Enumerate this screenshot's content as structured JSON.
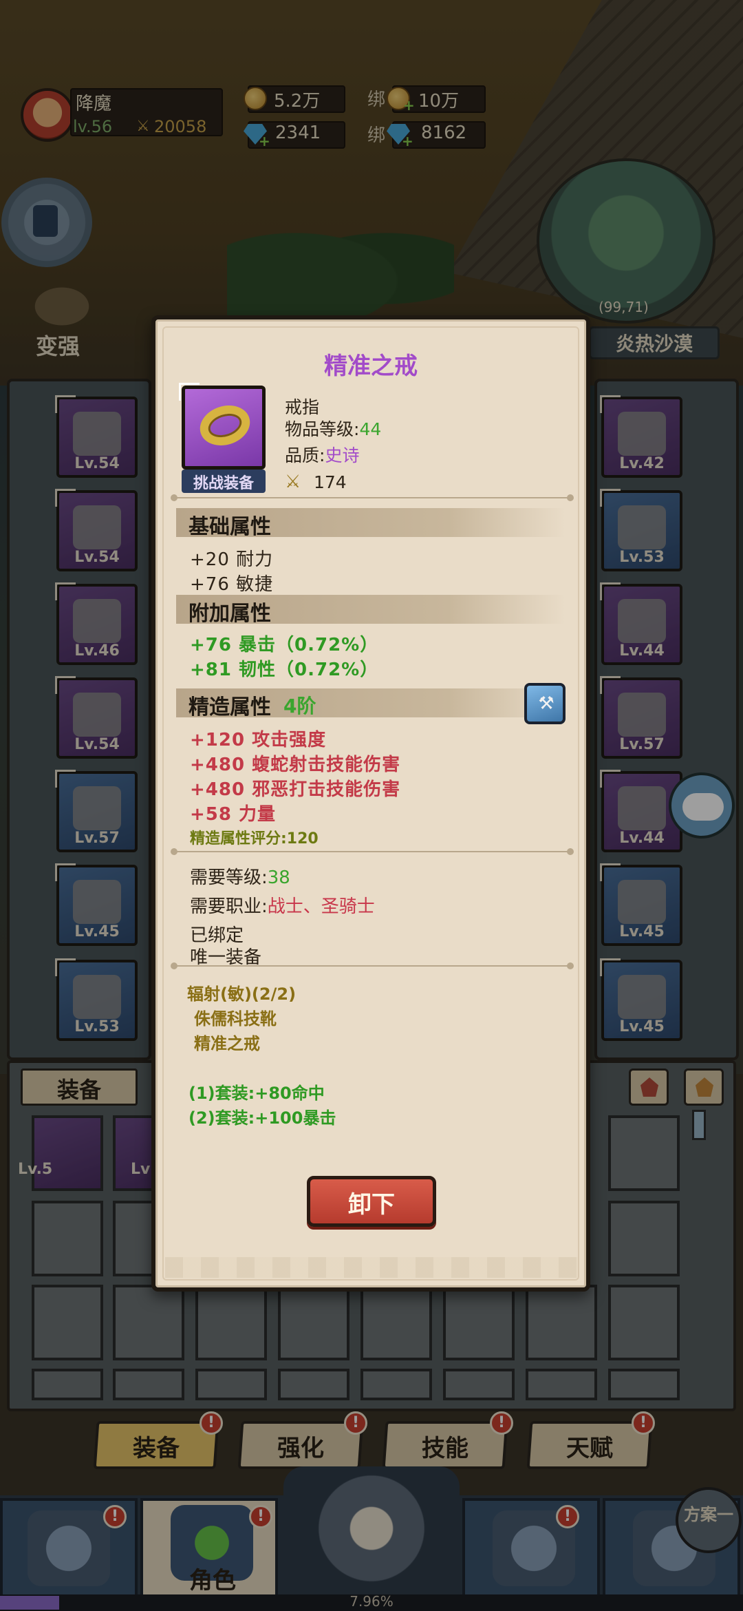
{
  "hud": {
    "player_name": "降魔",
    "level": "lv.56",
    "power": "20058",
    "gold": "5.2万",
    "bound_gold": "10万",
    "diamond": "2341",
    "bound_diamond": "8162",
    "bind_prefix": "绑"
  },
  "sidebar": {
    "stronger_label": "变强"
  },
  "minimap": {
    "coords": "(99,71)",
    "zone": "炎热沙漠"
  },
  "equipment_left": [
    {
      "lv": "Lv.54"
    },
    {
      "lv": "Lv.54"
    },
    {
      "lv": "Lv.46"
    },
    {
      "lv": "Lv.54"
    },
    {
      "lv": "Lv.57"
    },
    {
      "lv": "Lv.45"
    },
    {
      "lv": "Lv.53"
    }
  ],
  "equipment_right": [
    {
      "lv": "Lv.42"
    },
    {
      "lv": "Lv.53"
    },
    {
      "lv": "Lv.44"
    },
    {
      "lv": "Lv.57"
    },
    {
      "lv": "Lv.44"
    },
    {
      "lv": "Lv.45"
    },
    {
      "lv": "Lv.45"
    }
  ],
  "bag": {
    "tab_label": "装备",
    "first_item_lv": "Lv.5",
    "second_item_lv": "Lv"
  },
  "sub_tabs": [
    "装备",
    "强化",
    "技能",
    "天赋"
  ],
  "badge_mark": "!",
  "plan_button": "方案一",
  "nav": {
    "active_label": "角色",
    "progress": "7.96%",
    "progress_value": 0.0796
  },
  "item": {
    "name": "精准之戒",
    "type": "戒指",
    "item_level_label": "物品等级:",
    "item_level": "44",
    "quality_label": "品质:",
    "quality": "史诗",
    "score": "174",
    "challenge_tag": "挑战装备",
    "base_title": "基础属性",
    "base_stats": [
      "+20 耐力",
      "+76 敏捷"
    ],
    "extra_title": "附加属性",
    "extra_stats": [
      "+76 暴击（0.72%）",
      "+81 韧性（0.72%）"
    ],
    "refine_title": "精造属性",
    "refine_tier": "4阶",
    "refine_stats": [
      "+120 攻击强度",
      "+480 蝮蛇射击技能伤害",
      "+480 邪恶打击技能伤害",
      "+58 力量"
    ],
    "refine_score": "精造属性评分:120",
    "req_level_label": "需要等级:",
    "req_level": "38",
    "req_class_label": "需要职业:",
    "req_class": "战士、圣骑士",
    "bound": "已绑定",
    "unique": "唯一装备",
    "set_name": "辐射(敏)(2/2)",
    "set_pieces": [
      "侏儒科技靴",
      "精准之戒"
    ],
    "set_bonuses": [
      "(1)套装:+80命中",
      "(2)套装:+100暴击"
    ],
    "unequip_label": "卸下"
  },
  "colors": {
    "epic_purple": "#a24bc9",
    "stat_green": "#2f9a23",
    "stat_red": "#c33a48",
    "set_gold": "#8a6f15",
    "button_red": "#c8453a"
  },
  "icons": {
    "refine": "hammer-icon",
    "power": "crossed-swords-icon",
    "gold": "gold-coin-icon",
    "diamond": "diamond-icon"
  }
}
